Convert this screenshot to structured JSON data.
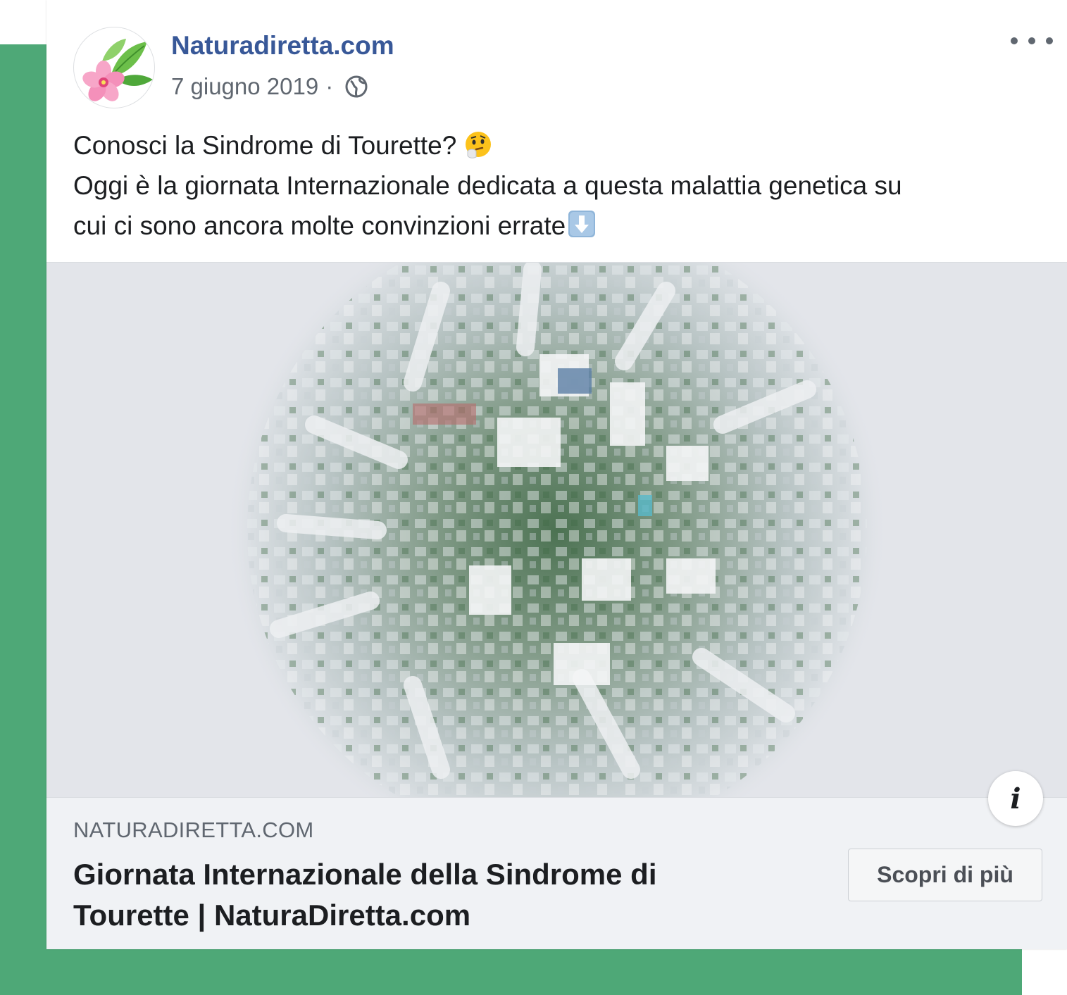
{
  "post": {
    "page_name": "Naturadiretta.com",
    "date": "7 giugno 2019",
    "separator": "·",
    "audience_icon": "globe-icon",
    "more_icon": "more-options-icon",
    "text_line1": "Conosci la Sindrome di Tourette?",
    "text_line2": "Oggi è la giornata Internazionale dedicata a questa malattia genetica su",
    "text_line3": "cui ci sono ancora molte convinzioni errate"
  },
  "link_preview": {
    "domain": "NATURADIRETTA.COM",
    "title_line1": "Giornata Internazionale della Sindrome di",
    "title_line2": "Tourette | NaturaDiretta.com",
    "cta_label": "Scopri di più",
    "info_icon": "info-icon",
    "info_label": "i"
  },
  "colors": {
    "background_green": "#4ea877",
    "page_name": "#385898",
    "link_box": "#f0f2f5"
  }
}
